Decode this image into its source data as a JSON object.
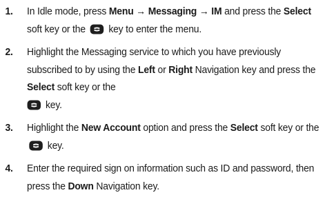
{
  "steps": [
    {
      "number": "1.",
      "t1": "In Idle mode, press ",
      "menu": "Menu",
      "arrow1": " → ",
      "messaging": "Messaging",
      "arrow2": " → ",
      "im": "IM",
      "t2": " and press the ",
      "select": "Select",
      "t3": " soft key or the ",
      "t4": " key to enter the menu.",
      "icon": "select-key-icon"
    },
    {
      "number": "2.",
      "t1": "Highlight the Messaging service to which you have previously subscribed to by using the ",
      "left": "Left",
      "t2": " or ",
      "right": "Right",
      "t3": " Navigation key and press the ",
      "select": "Select",
      "t4": " soft key or the ",
      "t5": " key.",
      "icon": "select-key-icon"
    },
    {
      "number": "3.",
      "t1": "Highlight the ",
      "new_account": "New Account",
      "t2": " option and press the ",
      "select": "Select",
      "t3": " soft key or the ",
      "t4": " key.",
      "icon": "select-key-icon"
    },
    {
      "number": "4.",
      "t1": "Enter the required sign on information such as ID and password, then press the ",
      "down": "Down",
      "t2": " Navigation key."
    }
  ]
}
